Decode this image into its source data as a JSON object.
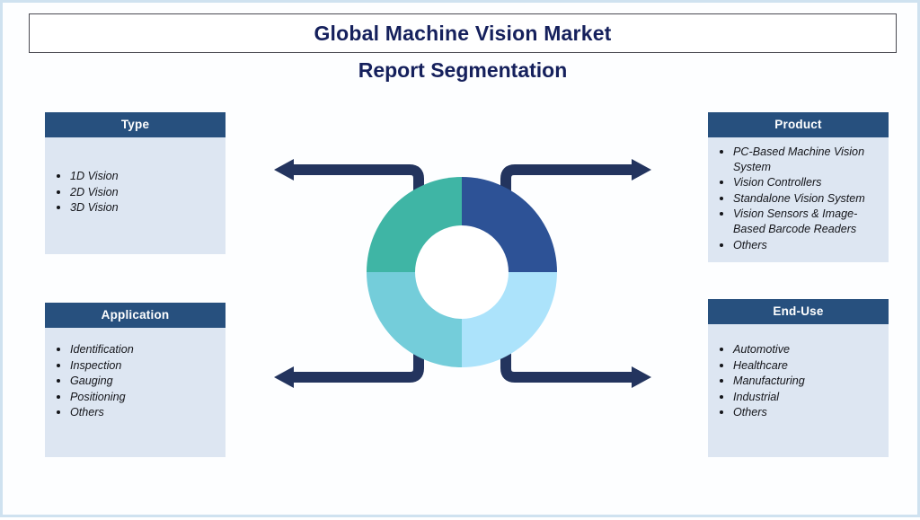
{
  "page": {
    "title": "Global Machine Vision Market",
    "subtitle": "Report Segmentation",
    "border_color": "#cfe2f0",
    "background": "#fdfeff"
  },
  "theme": {
    "header_bg": "#27507e",
    "header_text": "#ffffff",
    "panel_bg": "#dde6f2",
    "title_color": "#15205c",
    "arrow_color": "#23345e"
  },
  "segments": [
    {
      "id": "type",
      "header": "Type",
      "items": [
        "1D Vision",
        "2D Vision",
        "3D Vision"
      ]
    },
    {
      "id": "application",
      "header": "Application",
      "items": [
        "Identification",
        "Inspection",
        "Gauging",
        "Positioning",
        "Others"
      ]
    },
    {
      "id": "product",
      "header": "Product",
      "items": [
        "PC-Based Machine Vision System",
        "Vision Controllers",
        "Standalone Vision System",
        "Vision Sensors & Image-Based Barcode Readers",
        "Others"
      ]
    },
    {
      "id": "enduse",
      "header": "End-Use",
      "items": [
        "Automotive",
        "Healthcare",
        "Manufacturing",
        "Industrial",
        "Others"
      ]
    }
  ],
  "chart_data": {
    "type": "pie",
    "title": "Report Segmentation",
    "subtype": "donut",
    "legend_position": "none",
    "labels": [
      "Product",
      "End-Use",
      "Application",
      "Type"
    ],
    "values": [
      25,
      25,
      25,
      25
    ],
    "colors": [
      "#2d5296",
      "#ace3fb",
      "#74cdda",
      "#3fb5a5"
    ],
    "quadrants": [
      {
        "position": "top-right",
        "label": "Product",
        "value": 25,
        "color": "#2d5296"
      },
      {
        "position": "bottom-right",
        "label": "End-Use",
        "value": 25,
        "color": "#ace3fb"
      },
      {
        "position": "bottom-left",
        "label": "Application",
        "value": 25,
        "color": "#74cdda"
      },
      {
        "position": "top-left",
        "label": "Type",
        "value": 25,
        "color": "#3fb5a5"
      }
    ]
  }
}
